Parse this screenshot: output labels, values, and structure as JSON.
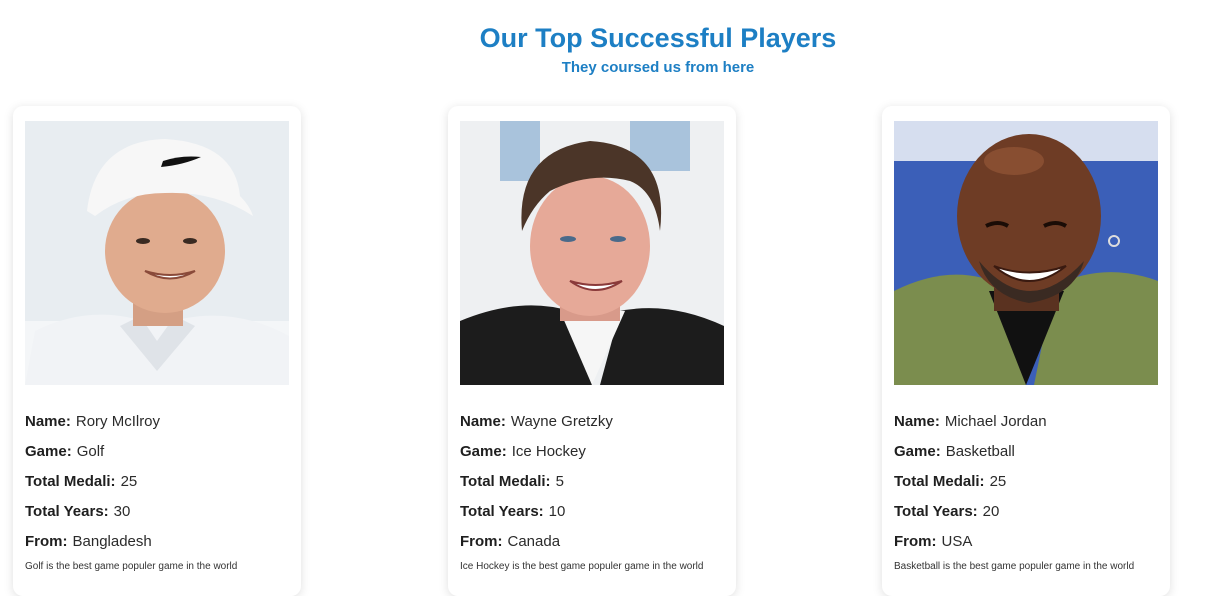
{
  "header": {
    "title": "Our Top Successful Players",
    "subtitle": "They coursed us from here"
  },
  "labels": {
    "name": "Name:",
    "game": "Game:",
    "medals": "Total Medali:",
    "years": "Total Years:",
    "from": "From:"
  },
  "players": [
    {
      "name": "Rory McIlroy",
      "game": "Golf",
      "medals": "25",
      "years": "30",
      "from": "Bangladesh",
      "description": "Golf is the best game populer game in the world",
      "photo_icon": "player-photo-icon"
    },
    {
      "name": "Wayne Gretzky",
      "game": "Ice Hockey",
      "medals": "5",
      "years": "10",
      "from": "Canada",
      "description": "Ice Hockey is the best game populer game in the world",
      "photo_icon": "player-photo-icon"
    },
    {
      "name": "Michael Jordan",
      "game": "Basketball",
      "medals": "25",
      "years": "20",
      "from": "USA",
      "description": "Basketball is the best game populer game in the world",
      "photo_icon": "player-photo-icon"
    }
  ],
  "colors": {
    "accent": "#1d7fc4"
  }
}
